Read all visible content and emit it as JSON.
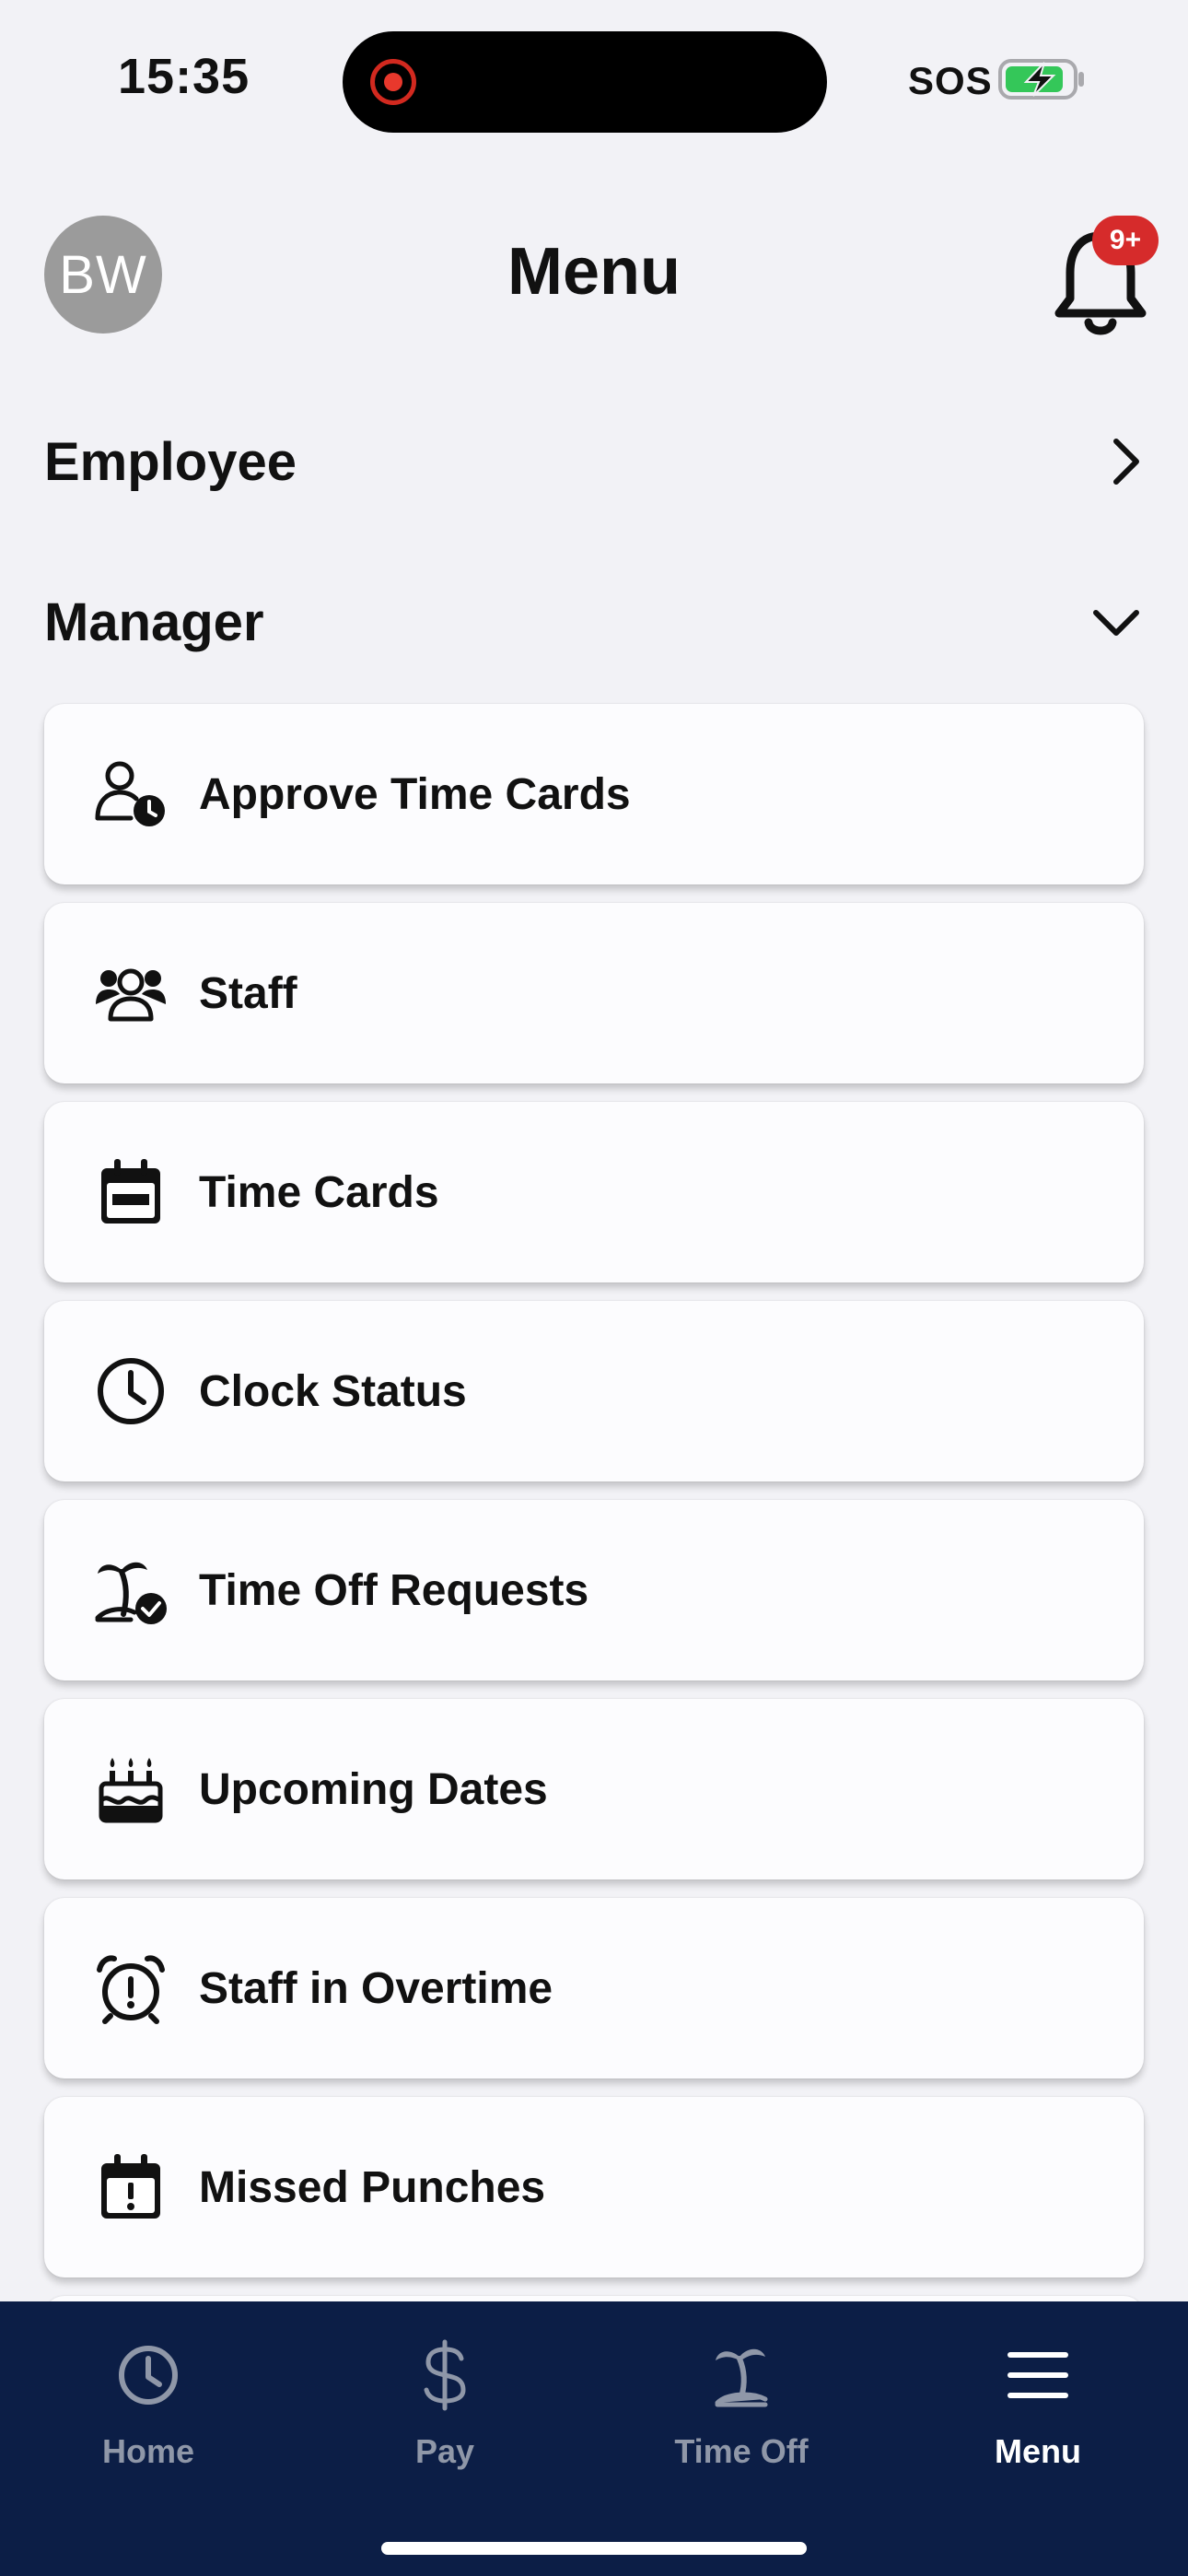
{
  "status_bar": {
    "time": "15:35",
    "carrier": "SOS"
  },
  "header": {
    "avatar_initials": "BW",
    "title": "Menu",
    "notification_badge": "9+"
  },
  "sections": {
    "employee_label": "Employee",
    "manager_label": "Manager"
  },
  "manager_items": [
    {
      "label": "Approve Time Cards",
      "icon": "user-clock-icon"
    },
    {
      "label": "Staff",
      "icon": "users-icon"
    },
    {
      "label": "Time Cards",
      "icon": "calendar-icon"
    },
    {
      "label": "Clock Status",
      "icon": "clock-icon"
    },
    {
      "label": "Time Off Requests",
      "icon": "palm-tree-check-icon"
    },
    {
      "label": "Upcoming Dates",
      "icon": "birthday-cake-icon"
    },
    {
      "label": "Staff in Overtime",
      "icon": "alarm-clock-icon"
    },
    {
      "label": "Missed Punches",
      "icon": "calendar-alert-icon"
    }
  ],
  "tab_bar": {
    "tabs": [
      {
        "label": "Home",
        "icon": "clock-icon",
        "active": false
      },
      {
        "label": "Pay",
        "icon": "dollar-icon",
        "active": false
      },
      {
        "label": "Time Off",
        "icon": "palm-tree-icon",
        "active": false
      },
      {
        "label": "Menu",
        "icon": "hamburger-icon",
        "active": true
      }
    ]
  },
  "colors": {
    "background": "#f2f2f6",
    "tab_bar": "#0c1e46",
    "badge": "#d62b2b",
    "avatar": "#9b9b9b",
    "inactive_tab": "#8f97a8"
  }
}
